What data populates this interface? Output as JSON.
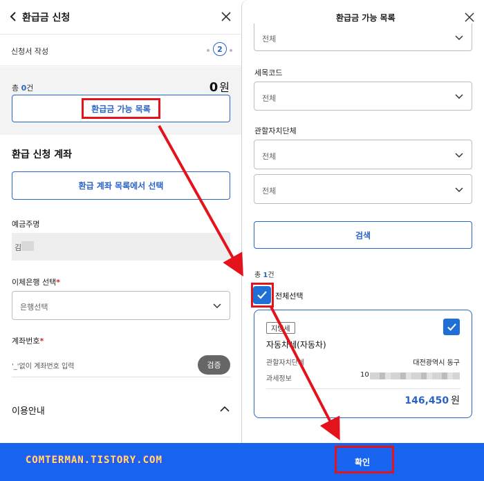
{
  "left": {
    "title": "환급금 신청",
    "step_label": "신청서 작성",
    "step_number": "2",
    "total_prefix": "총 ",
    "total_count": "0",
    "total_suffix": "건",
    "total_amount": "0",
    "total_unit": "원",
    "refund_list_button": "환급금 가능 목록",
    "account_section_title": "환급 신청 계좌",
    "account_select_button": "환급 계좌 목록에서 선택",
    "depositor_label": "예금주명",
    "depositor_value": "김",
    "bank_label": "이체은행 선택",
    "bank_placeholder": "은행선택",
    "account_label": "계좌번호",
    "account_placeholder": "'_'없이 계좌번호 입력",
    "verify_button": "검증",
    "info_label": "이용안내",
    "required_mark": "*"
  },
  "right": {
    "title": "환급금 가능 목록",
    "select_top": "전체",
    "tax_code_label": "세목코드",
    "tax_code_value": "전체",
    "local_gov_label": "관할자치단체",
    "local_gov_value_1": "전체",
    "local_gov_value_2": "전체",
    "search_button": "검색",
    "count_prefix": "총 ",
    "count_value": "1",
    "count_suffix": "건",
    "select_all_label": "전체선택",
    "card": {
      "badge": "지방세",
      "title": "자동차세(자동차)",
      "row1_label": "관할자치단체",
      "row1_value": "대전광역시 동구",
      "row2_label": "과세정보",
      "row2_value": "10",
      "amount": "146,450",
      "amount_unit": "원"
    },
    "confirm_button": "확인"
  },
  "watermark": "COMTERMAN.TISTORY.COM",
  "colors": {
    "accent": "#2a63c8",
    "footer": "#1864ee",
    "annotation": "#e3121b"
  }
}
